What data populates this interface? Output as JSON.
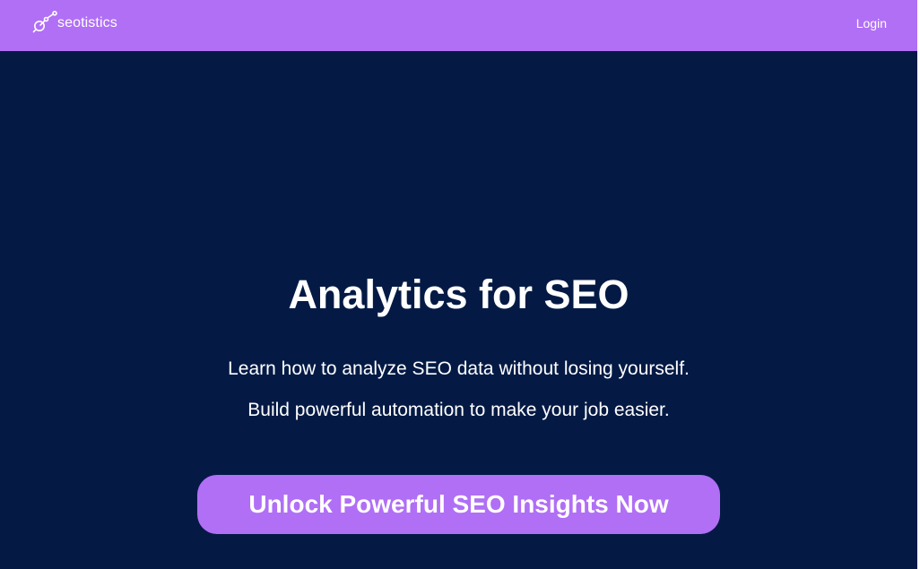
{
  "header": {
    "brand": "seotistics",
    "logo_icon": "satellite-link-icon",
    "login_label": "Login",
    "background_color": "#b06ff5"
  },
  "hero": {
    "title": "Analytics for SEO",
    "lines": [
      "Learn how to analyze SEO data without losing yourself.",
      "Build powerful automation to make your job easier."
    ],
    "cta_label": "Unlock Powerful SEO Insights Now",
    "background_color": "#041a45",
    "accent_color": "#b06ff5"
  }
}
